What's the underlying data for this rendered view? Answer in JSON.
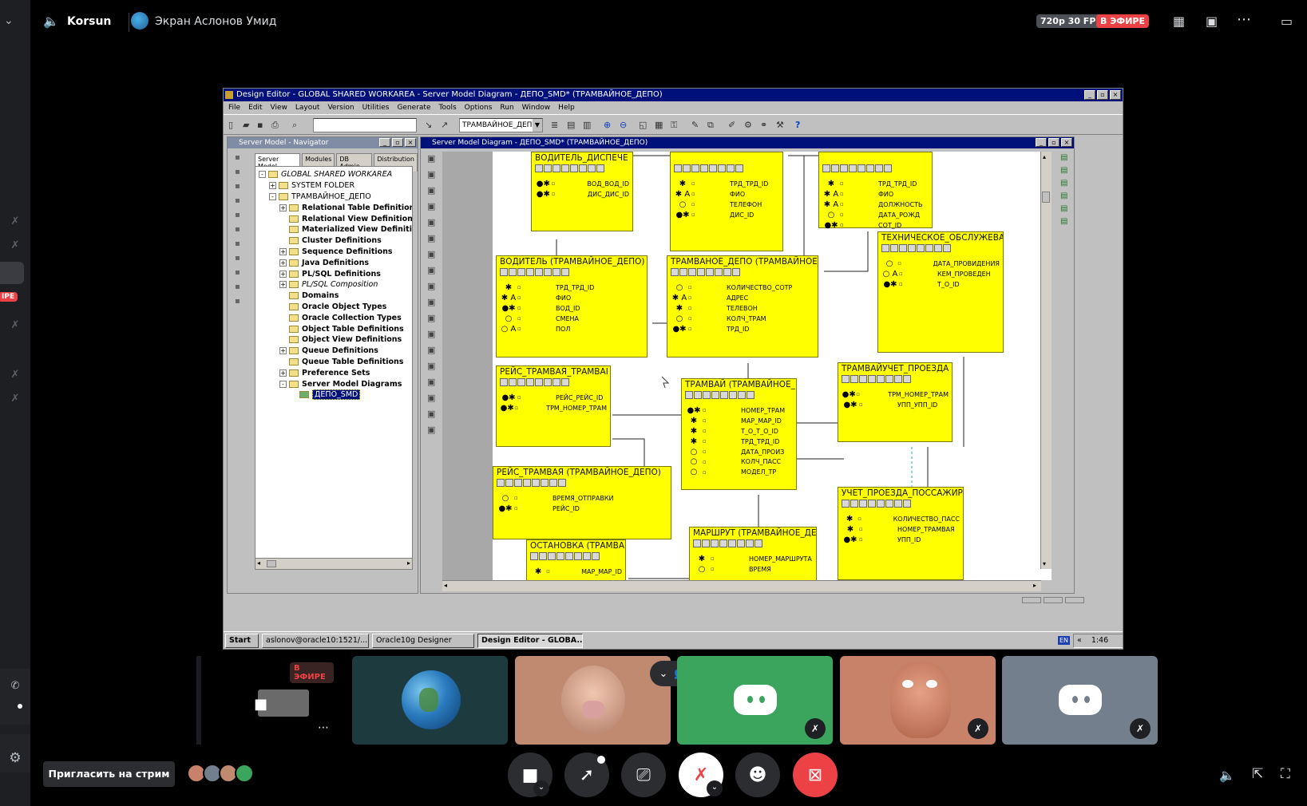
{
  "stream": {
    "streamer": "Korsun",
    "screen_title": "Экран Аслонов Умид",
    "quality": "720p 30 FPS",
    "live_badge": "В ЭФИРЕ",
    "left_badge": "IPE",
    "invite_label": "Пригласить на стрим"
  },
  "app": {
    "title": "Design Editor - GLOBAL SHARED WORKAREA - Server Model Diagram - ДЕПО_SMD* (ТРАМВАЙНОЕ_ДЕПО)",
    "menu": [
      "File",
      "Edit",
      "View",
      "Layout",
      "Version",
      "Utilities",
      "Generate",
      "Tools",
      "Options",
      "Run",
      "Window",
      "Help"
    ],
    "toolbar_combo": "ТРАМВАЙНОЕ_ДЕПО",
    "help_glyph": "?"
  },
  "navigator": {
    "title": "Server Model - Navigator",
    "tabs": [
      "Server Model",
      "Modules",
      "DB Admin",
      "Distribution"
    ],
    "tree": [
      {
        "label": "GLOBAL SHARED WORKAREA",
        "level": 0,
        "italic": true,
        "pm": "-"
      },
      {
        "label": "SYSTEM FOLDER",
        "level": 1,
        "pm": "+"
      },
      {
        "label": "ТРАМВАЙНОЕ_ДЕПО",
        "level": 1,
        "pm": "-"
      },
      {
        "label": "Relational Table Definitions",
        "level": 2,
        "bold": true,
        "pm": "+"
      },
      {
        "label": "Relational View Definitions",
        "level": 2,
        "bold": true,
        "pm": ""
      },
      {
        "label": "Materialized View Definitio",
        "level": 2,
        "bold": true,
        "pm": ""
      },
      {
        "label": "Cluster Definitions",
        "level": 2,
        "bold": true,
        "pm": ""
      },
      {
        "label": "Sequence Definitions",
        "level": 2,
        "bold": true,
        "pm": "+"
      },
      {
        "label": "Java Definitions",
        "level": 2,
        "bold": true,
        "pm": "+"
      },
      {
        "label": "PL/SQL Definitions",
        "level": 2,
        "bold": true,
        "pm": "+"
      },
      {
        "label": "PL/SQL Composition",
        "level": 2,
        "italic": true,
        "pm": "+"
      },
      {
        "label": "Domains",
        "level": 2,
        "bold": true,
        "pm": ""
      },
      {
        "label": "Oracle Object Types",
        "level": 2,
        "bold": true,
        "pm": ""
      },
      {
        "label": "Oracle Collection Types",
        "level": 2,
        "bold": true,
        "pm": ""
      },
      {
        "label": "Object Table Definitions",
        "level": 2,
        "bold": true,
        "pm": ""
      },
      {
        "label": "Object View Definitions",
        "level": 2,
        "bold": true,
        "pm": ""
      },
      {
        "label": "Queue Definitions",
        "level": 2,
        "bold": true,
        "pm": "+"
      },
      {
        "label": "Queue Table Definitions",
        "level": 2,
        "bold": true,
        "pm": ""
      },
      {
        "label": "Preference Sets",
        "level": 2,
        "bold": true,
        "pm": "+"
      },
      {
        "label": "Server Model Diagrams",
        "level": 2,
        "bold": true,
        "pm": "-"
      },
      {
        "label": "ДЕПО_SMD",
        "level": 3,
        "selected": true,
        "pm": ""
      }
    ]
  },
  "diagram": {
    "title": "Server Model Diagram - ДЕПО_SMD* (ТРАМВАЙНОЕ_ДЕПО)",
    "entities": [
      {
        "name": "ВОДИТЕЛЬ_ДИСПЕЧЕ",
        "rows": [
          [
            "●✱",
            "ВОД_ВОД_ID"
          ],
          [
            "●✱",
            "ДИС_ДИС_ID"
          ]
        ]
      },
      {
        "name": "",
        "rows": [
          [
            "✱",
            "ТРД_ТРД_ID"
          ],
          [
            "✱ A",
            "ФИО"
          ],
          [
            "○",
            "ТЕЛЕФОН"
          ],
          [
            "●✱",
            "ДИС_ID"
          ]
        ]
      },
      {
        "name": "",
        "rows": [
          [
            "✱",
            "ТРД_ТРД_ID"
          ],
          [
            "✱ A",
            "ФИО"
          ],
          [
            "✱ A",
            "ДОЛЖНОСТЬ"
          ],
          [
            "○",
            "ДАТА_РОЖД"
          ],
          [
            "●✱",
            "СОТ_ID"
          ]
        ]
      },
      {
        "name": "ВОДИТЕЛЬ (ТРАМВАЙНОЕ_ДЕПО)",
        "rows": [
          [
            "✱",
            "ТРД_ТРД_ID"
          ],
          [
            "✱ A",
            "ФИО"
          ],
          [
            "●✱",
            "ВОД_ID"
          ],
          [
            "○",
            "СМЕНА"
          ],
          [
            "○ A",
            "ПОЛ"
          ]
        ]
      },
      {
        "name": "ТРАМВАНОЕ_ДЕПО (ТРАМВАЙНОЕ_",
        "rows": [
          [
            "○",
            "КОЛИЧЕСТВО_СОТР"
          ],
          [
            "✱ A",
            "АДРЕС"
          ],
          [
            "✱",
            "ТЕЛЕВОН"
          ],
          [
            "○",
            "КОЛЧ_ТРАМ"
          ],
          [
            "●✱",
            "ТРД_ID"
          ]
        ]
      },
      {
        "name": "ТЕХНИЧЕСКОЕ_ОБСЛУЖЕВА",
        "rows": [
          [
            "○",
            "ДАТА_ПРОВИДЕНИЯ"
          ],
          [
            "○ A",
            "КЕМ_ПРОВЕДЕН"
          ],
          [
            "●✱",
            "Т_О_ID"
          ]
        ]
      },
      {
        "name": "РЕЙС_ТРАМВАЯ_ТРАМВАІ",
        "rows": [
          [
            "●✱",
            "РЕЙС_РЕЙС_ID"
          ],
          [
            "●✱",
            "ТРМ_НОМЕР_ТРАМ"
          ]
        ]
      },
      {
        "name": "ТРАМВАЙ (ТРАМВАЙНОЕ_",
        "rows": [
          [
            "●✱",
            "НОМЕР_ТРАМ"
          ],
          [
            "✱",
            "МАР_МАР_ID"
          ],
          [
            "✱",
            "Т_О_Т_О_ID"
          ],
          [
            "✱",
            "ТРД_ТРД_ID"
          ],
          [
            "○",
            "ДАТА_ПРОИЗ"
          ],
          [
            "○",
            "КОЛЧ_ПАСС"
          ],
          [
            "○",
            "МОДЕЛ_ТР"
          ]
        ]
      },
      {
        "name": "ТРАМВАЙУЧЕТ_ПРОЕЗДА",
        "rows": [
          [
            "●✱",
            "ТРМ_НОМЕР_ТРАМ"
          ],
          [
            "●✱",
            "УПП_УПП_ID"
          ]
        ]
      },
      {
        "name": "РЕЙС_ТРАМВАЯ (ТРАМВАЙНОЕ_ДЕПО)",
        "rows": [
          [
            "○",
            "ВРЕМЯ_ОТПРАВКИ"
          ],
          [
            "●✱",
            "РЕЙС_ID"
          ]
        ]
      },
      {
        "name": "УЧЕТ_ПРОЕЗДА_ПОССАЖИР",
        "rows": [
          [
            "✱",
            "КОЛИЧЕСТВО_ПАСС"
          ],
          [
            "✱",
            "НОМЕР_ТРАМВАЯ"
          ],
          [
            "●✱",
            "УПП_ID"
          ]
        ]
      },
      {
        "name": "ОСТАНОВКА (ТРАМВАЙ",
        "rows": [
          [
            "✱",
            "МАР_МАР_ID"
          ]
        ]
      },
      {
        "name": "МАРШРУТ (ТРАМВАЙНОЕ_ДЕІ",
        "rows": [
          [
            "✱",
            "НОМЕР_МАРШРУТА"
          ],
          [
            "○",
            "ВРЕМЯ"
          ]
        ]
      }
    ]
  },
  "taskbar": {
    "start": "Start",
    "items": [
      "aslonov@oracle10:1521/...",
      "Oracle10g Designer",
      "Design Editor - GLOBA..."
    ],
    "lang": "EN",
    "clock": "1:46",
    "arrows": "«"
  },
  "colors": {
    "live_red": "#ed4245",
    "discord_green": "#3ba55d",
    "discord_grey": "#747f8d",
    "entity_yellow": "#ffff00",
    "win_blue": "#00107a"
  }
}
